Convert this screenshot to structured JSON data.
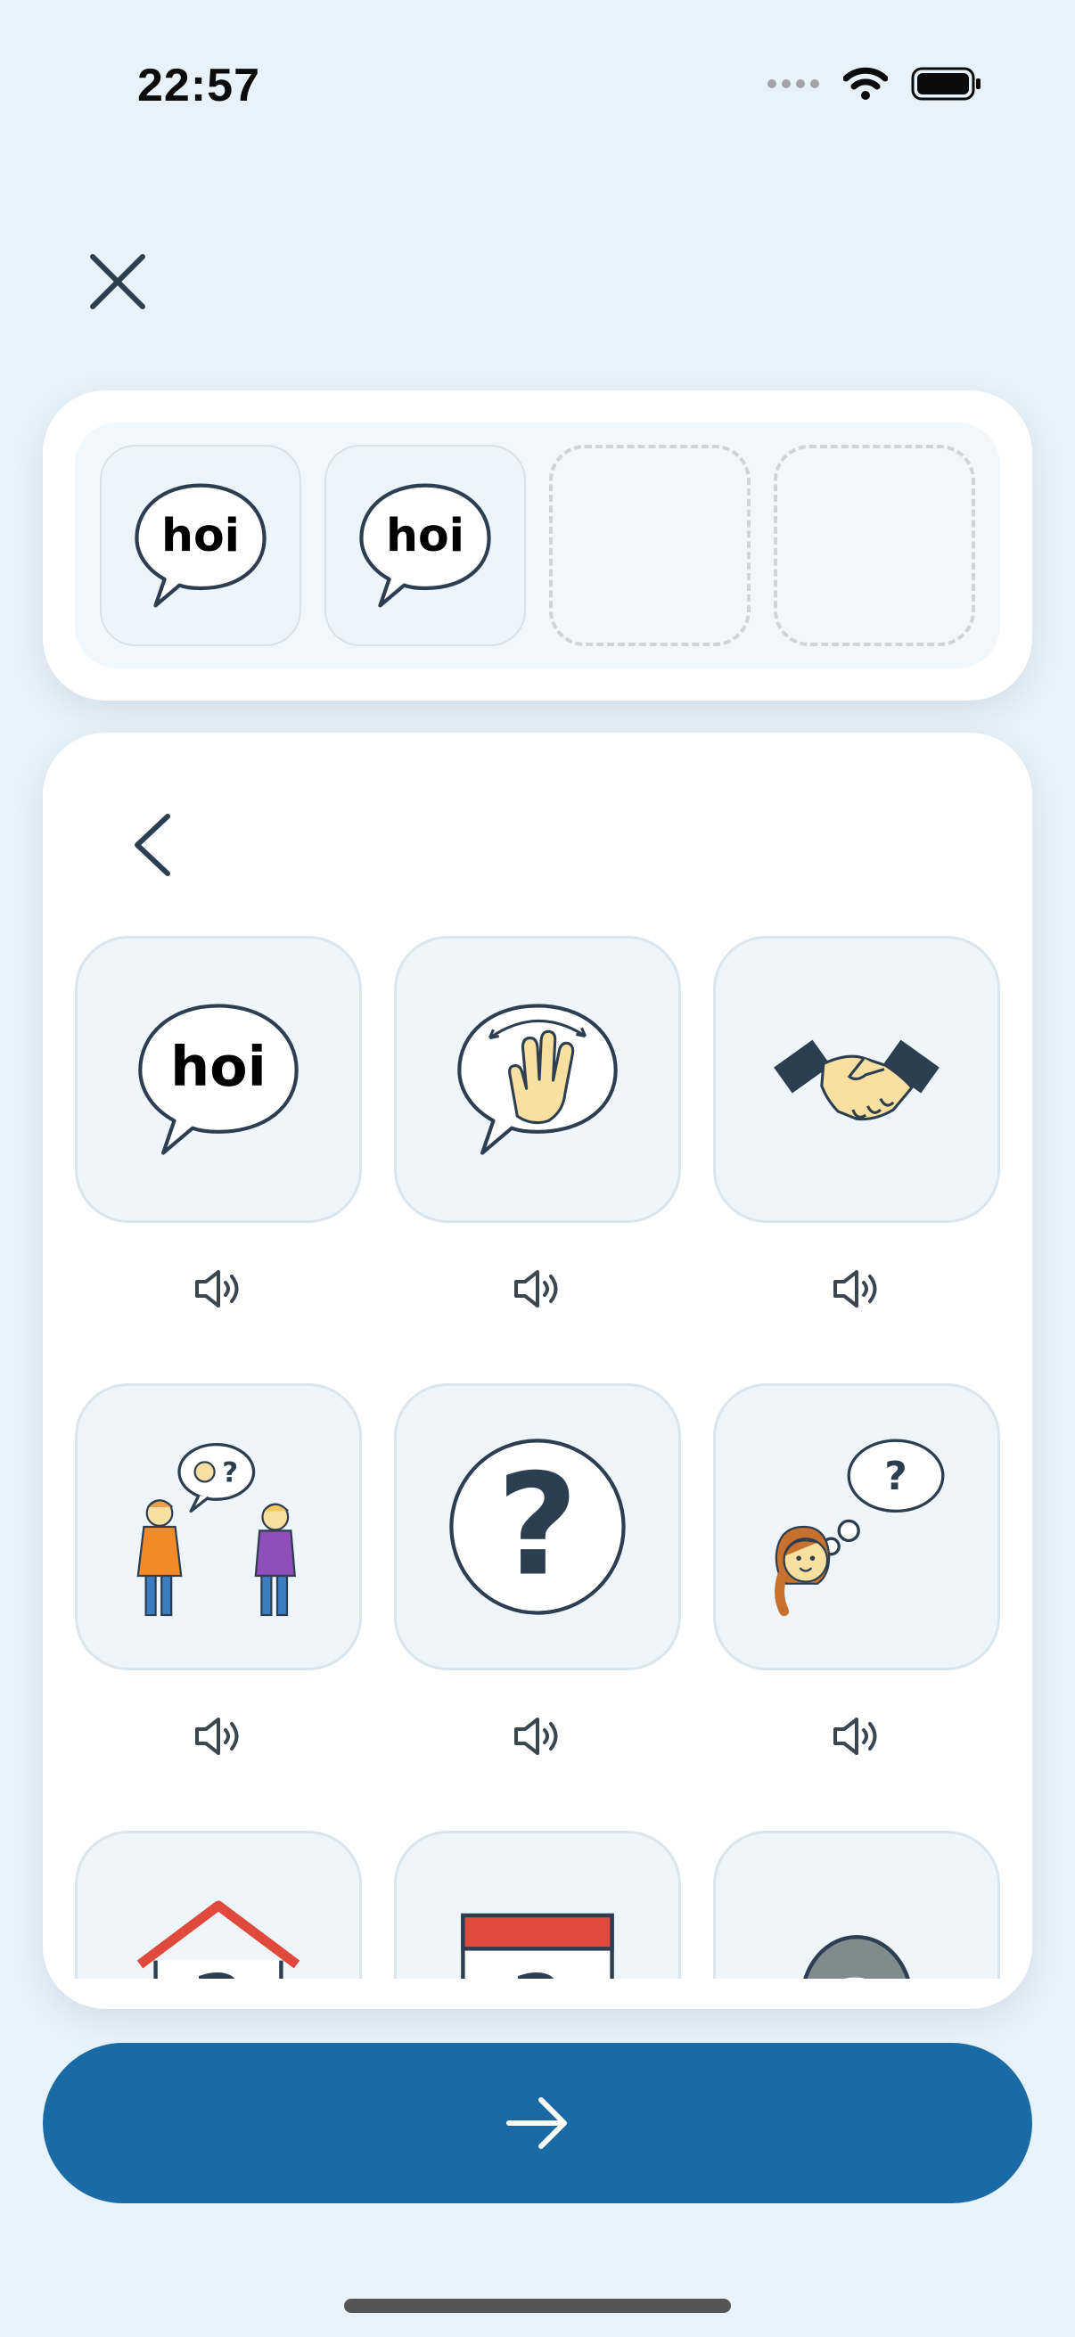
{
  "status_bar": {
    "time": "22:57",
    "icons": [
      "signal-dots-icon",
      "wifi-icon",
      "battery-icon"
    ]
  },
  "toolbar": {
    "close_icon": "close-icon"
  },
  "sentence_strip": {
    "slots": [
      {
        "filled": true,
        "word": "hoi",
        "icon": "speech-bubble-hoi-icon"
      },
      {
        "filled": true,
        "word": "hoi",
        "icon": "speech-bubble-hoi-icon"
      },
      {
        "filled": false
      },
      {
        "filled": false
      }
    ]
  },
  "grid": {
    "back_icon": "chevron-left-icon",
    "tiles": [
      {
        "icon": "speech-bubble-hoi-icon",
        "word": "hoi"
      },
      {
        "icon": "waving-hand-icon"
      },
      {
        "icon": "handshake-icon"
      },
      {
        "icon": "two-people-asking-icon",
        "symbol": "?"
      },
      {
        "icon": "question-mark-icon",
        "symbol": "?"
      },
      {
        "icon": "girl-thinking-icon",
        "symbol": "?"
      },
      {
        "icon": "house-question-icon",
        "symbol": "?"
      },
      {
        "icon": "calendar-question-icon",
        "symbol": "?"
      },
      {
        "icon": "grey-question-icon",
        "symbol": "?"
      }
    ],
    "speaker_icon": "speaker-icon"
  },
  "next_button": {
    "icon": "arrow-right-icon"
  },
  "colors": {
    "background": "#e8f2fa",
    "primary": "#1a6aa5",
    "tile": "#eef6fc",
    "ink": "#2c3e50"
  }
}
